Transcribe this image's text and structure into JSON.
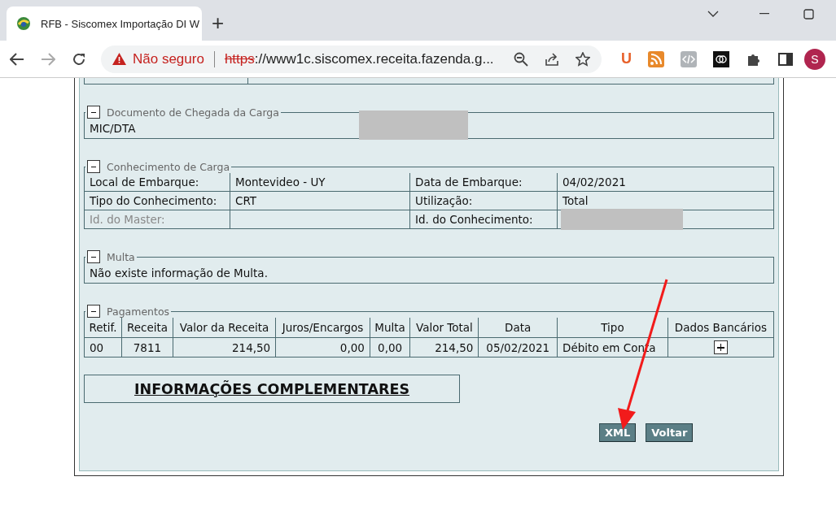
{
  "browser": {
    "tab_title": "RFB - Siscomex Importação DI W",
    "new_tab": "+",
    "security": "Não seguro",
    "url_scheme": "https",
    "url_rest": "://www1c.siscomex.receita.fazenda.g...",
    "extension_letter": "U",
    "profile": "S"
  },
  "sections": [
    {
      "kind": "text",
      "title": "Documento de Chegada da Carga",
      "expanded": true,
      "text": "MIC/DTA",
      "redacted": true
    },
    {
      "kind": "grid",
      "title": "Conhecimento de Carga",
      "expanded": true,
      "rows": [
        [
          {
            "label": "Local de Embarque:",
            "value": "Montevideo - UY",
            "dimmed": false
          },
          {
            "label": "Data de Embarque:",
            "value": "04/02/2021",
            "dimmed": false
          }
        ],
        [
          {
            "label": "Tipo do Conhecimento:",
            "value": "CRT",
            "dimmed": false
          },
          {
            "label": "Utilização:",
            "value": "Total",
            "dimmed": false
          }
        ],
        [
          {
            "label": "Id. do Master:",
            "dimmed": true
          },
          {
            "label": "Id. do Conhecimento:",
            "dimmed": false,
            "redacted": true
          }
        ]
      ]
    },
    {
      "kind": "text",
      "title": "Multa",
      "expanded": true,
      "text": "Não existe informação de Multa.",
      "redacted": false
    },
    {
      "kind": "table",
      "title": "Pagamentos",
      "expanded": true,
      "columns": [
        "Retif.",
        "Receita",
        "Valor da Receita",
        "Juros/Encargos",
        "Multa",
        "Valor Total",
        "Data",
        "Tipo",
        "Dados Bancários"
      ],
      "rows": [
        {
          "cells": [
            "00",
            "7811",
            "214,50",
            "0,00",
            "0,00",
            "214,50",
            "05/02/2021",
            "Débito em Conta"
          ],
          "details_expanded": false
        }
      ]
    }
  ],
  "info_link": "INFORMAÇÕES COMPLEMENTARES",
  "buttons": [
    "XML",
    "Voltar"
  ]
}
